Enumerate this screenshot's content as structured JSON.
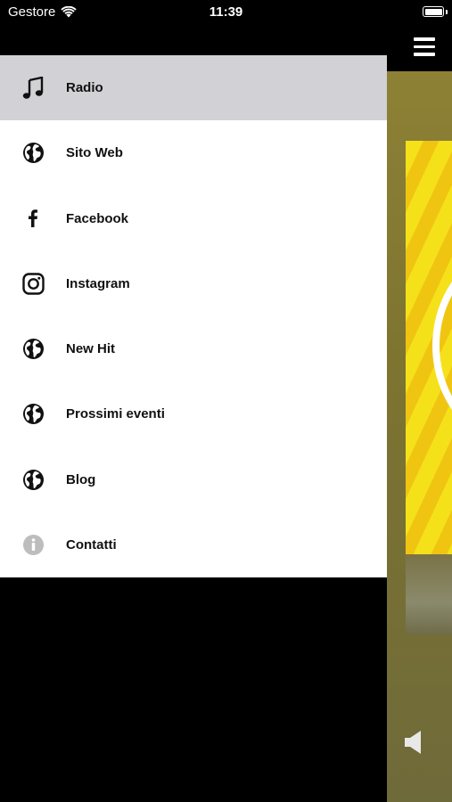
{
  "status_bar": {
    "carrier": "Gestore",
    "time": "11:39"
  },
  "menu": {
    "items": [
      {
        "label": "Radio",
        "icon": "music-note-icon",
        "selected": true
      },
      {
        "label": "Sito Web",
        "icon": "globe-icon",
        "selected": false
      },
      {
        "label": "Facebook",
        "icon": "facebook-icon",
        "selected": false
      },
      {
        "label": "Instagram",
        "icon": "instagram-icon",
        "selected": false
      },
      {
        "label": "New Hit",
        "icon": "globe-icon",
        "selected": false
      },
      {
        "label": "Prossimi eventi",
        "icon": "globe-icon",
        "selected": false
      },
      {
        "label": "Blog",
        "icon": "globe-icon",
        "selected": false
      },
      {
        "label": "Contatti",
        "icon": "info-icon",
        "selected": false
      }
    ]
  },
  "colors": {
    "selected_bg": "#d1d1d6",
    "menu_bg": "#ffffff",
    "app_bg": "#000000",
    "artwork_yellow": "#f5e11a"
  }
}
